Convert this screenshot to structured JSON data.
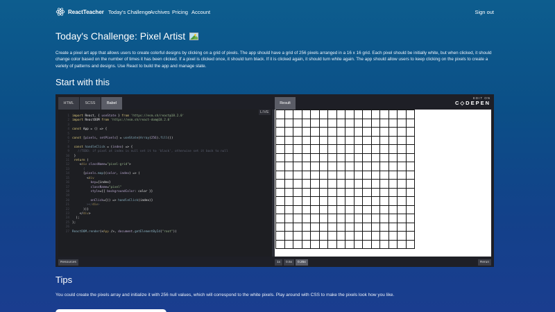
{
  "nav": {
    "logo_text": "ReactTeacher",
    "links": [
      "Today's Challenge",
      "Archives",
      "Pricing",
      "Account"
    ],
    "signout": "Sign out"
  },
  "page": {
    "title": "Today's Challenge: Pixel Artist",
    "title_icon": "framed-picture-icon",
    "description": "Create a pixel art app that allows users to create colorful designs by clicking on a grid of pixels. The app should have a grid of 256 pixels arranged in a 16 x 16 grid. Each pixel should be initially white, but when clicked, it should change color based on the number of times it has been clicked. If a pixel is clicked once, it should turn black. If it is clicked again, it should turn white again. The app should allow users to keep clicking on the pixels to create a variety of patterns and designs. Use React to build the app and manage state.",
    "start_heading": "Start with this",
    "tips_heading": "Tips",
    "tips_text": "You could create the pixels array and initialize it with 256 null values, which will correspond to the white pixels. Play around with CSS to make the pixels look how you like."
  },
  "embed": {
    "tabs": [
      "HTML",
      "SCSS",
      "Babel"
    ],
    "active_tab": "Babel",
    "result_tab": "Result",
    "edit_on": "EDIT ON",
    "codepen": "C◇DEPEN",
    "live_badge": "LIVE",
    "resources_button": "Resources",
    "zoom_options": [
      "1x",
      "0.5x",
      "0.25x"
    ],
    "active_zoom": "0.25x",
    "rerun_button": "Rerun",
    "grid": {
      "rows": 16,
      "cols": 16,
      "pixel_color": "#ffffff",
      "border_color": "#111111"
    },
    "code_lines": [
      [
        [
          "k",
          "import"
        ],
        [
          "p",
          " React, { "
        ],
        [
          "v",
          "useState"
        ],
        [
          "p",
          " } "
        ],
        [
          "k",
          "from"
        ],
        [
          "s",
          " 'https://esm.sh/react@18.2.0'"
        ]
      ],
      [
        [
          "k",
          "import"
        ],
        [
          "p",
          " ReactDOM "
        ],
        [
          "k",
          "from"
        ],
        [
          "s",
          " 'https://esm.sh/react-dom@18.2.0'"
        ]
      ],
      [],
      [
        [
          "k",
          "const"
        ],
        [
          "p",
          " App = () => {"
        ]
      ],
      [],
      [
        [
          "k",
          "const"
        ],
        [
          "p",
          " ["
        ],
        [
          "v",
          "pixels"
        ],
        [
          "p",
          ", "
        ],
        [
          "v",
          "setPixels"
        ],
        [
          "p",
          "] = "
        ],
        [
          "f",
          "useState"
        ],
        [
          "p",
          "("
        ],
        [
          "f",
          "Array"
        ],
        [
          "p",
          "("
        ],
        [
          "v",
          "256"
        ],
        [
          "p",
          ")."
        ],
        [
          "f",
          "fill"
        ],
        [
          "p",
          "())"
        ]
      ],
      [],
      [
        [
          "k",
          " const"
        ],
        [
          "p",
          " "
        ],
        [
          "f",
          "handleClick"
        ],
        [
          "p",
          " = ("
        ],
        [
          "v",
          "index"
        ],
        [
          "p",
          ") => {"
        ]
      ],
      [
        [
          "c",
          "   //TODO: if pixel at index is null set it to 'black', otherwise set it back to null"
        ]
      ],
      [
        [
          "p",
          " }"
        ]
      ],
      [
        [
          "k",
          " return"
        ],
        [
          "p",
          " ("
        ]
      ],
      [
        [
          "p",
          "    <"
        ],
        [
          "t",
          "div"
        ],
        [
          "p",
          " "
        ],
        [
          "v",
          "className"
        ],
        [
          "p",
          "="
        ],
        [
          "s",
          "\"pixel-grid\""
        ],
        [
          "p",
          ">"
        ]
      ],
      [
        [
          "c",
          "      {"
        ]
      ],
      [
        [
          "p",
          "      {"
        ],
        [
          "v",
          "pixels"
        ],
        [
          "p",
          "."
        ],
        [
          "f",
          "map"
        ],
        [
          "p",
          "(("
        ],
        [
          "v",
          "color"
        ],
        [
          "p",
          ", "
        ],
        [
          "v",
          "index"
        ],
        [
          "p",
          ") => ("
        ]
      ],
      [
        [
          "p",
          "        <"
        ],
        [
          "t",
          "div"
        ]
      ],
      [
        [
          "p",
          "          "
        ],
        [
          "v",
          "key"
        ],
        [
          "p",
          "={index}"
        ]
      ],
      [
        [
          "p",
          "          "
        ],
        [
          "v",
          "className"
        ],
        [
          "p",
          "="
        ],
        [
          "s",
          "\"pixel\""
        ]
      ],
      [
        [
          "p",
          "          "
        ],
        [
          "v",
          "style"
        ],
        [
          "p",
          "={{ "
        ],
        [
          "v",
          "backgroundColor"
        ],
        [
          "p",
          ": color }}"
        ]
      ],
      [],
      [
        [
          "p",
          "          "
        ],
        [
          "v",
          "onClick"
        ],
        [
          "p",
          "={() => "
        ],
        [
          "f",
          "handleClick"
        ],
        [
          "p",
          "(index)}"
        ]
      ],
      [
        [
          "c",
          "        ></"
        ],
        [
          "t",
          "div"
        ],
        [
          "c",
          ">"
        ]
      ],
      [
        [
          "p",
          "      ))}"
        ]
      ],
      [
        [
          "p",
          "    </"
        ],
        [
          "t",
          "div"
        ],
        [
          "p",
          ">"
        ]
      ],
      [
        [
          "p",
          "  );"
        ]
      ],
      [
        [
          "p",
          "};"
        ]
      ],
      [],
      [
        [
          "f",
          "ReactDOM"
        ],
        [
          "p",
          "."
        ],
        [
          "f",
          "render"
        ],
        [
          "p",
          "(<"
        ],
        [
          "t",
          "App"
        ],
        [
          "p",
          " />, "
        ],
        [
          "v",
          "document"
        ],
        [
          "p",
          "."
        ],
        [
          "f",
          "getElementById"
        ],
        [
          "p",
          "("
        ],
        [
          "s",
          "\"root\""
        ],
        [
          "p",
          "))"
        ]
      ]
    ]
  }
}
